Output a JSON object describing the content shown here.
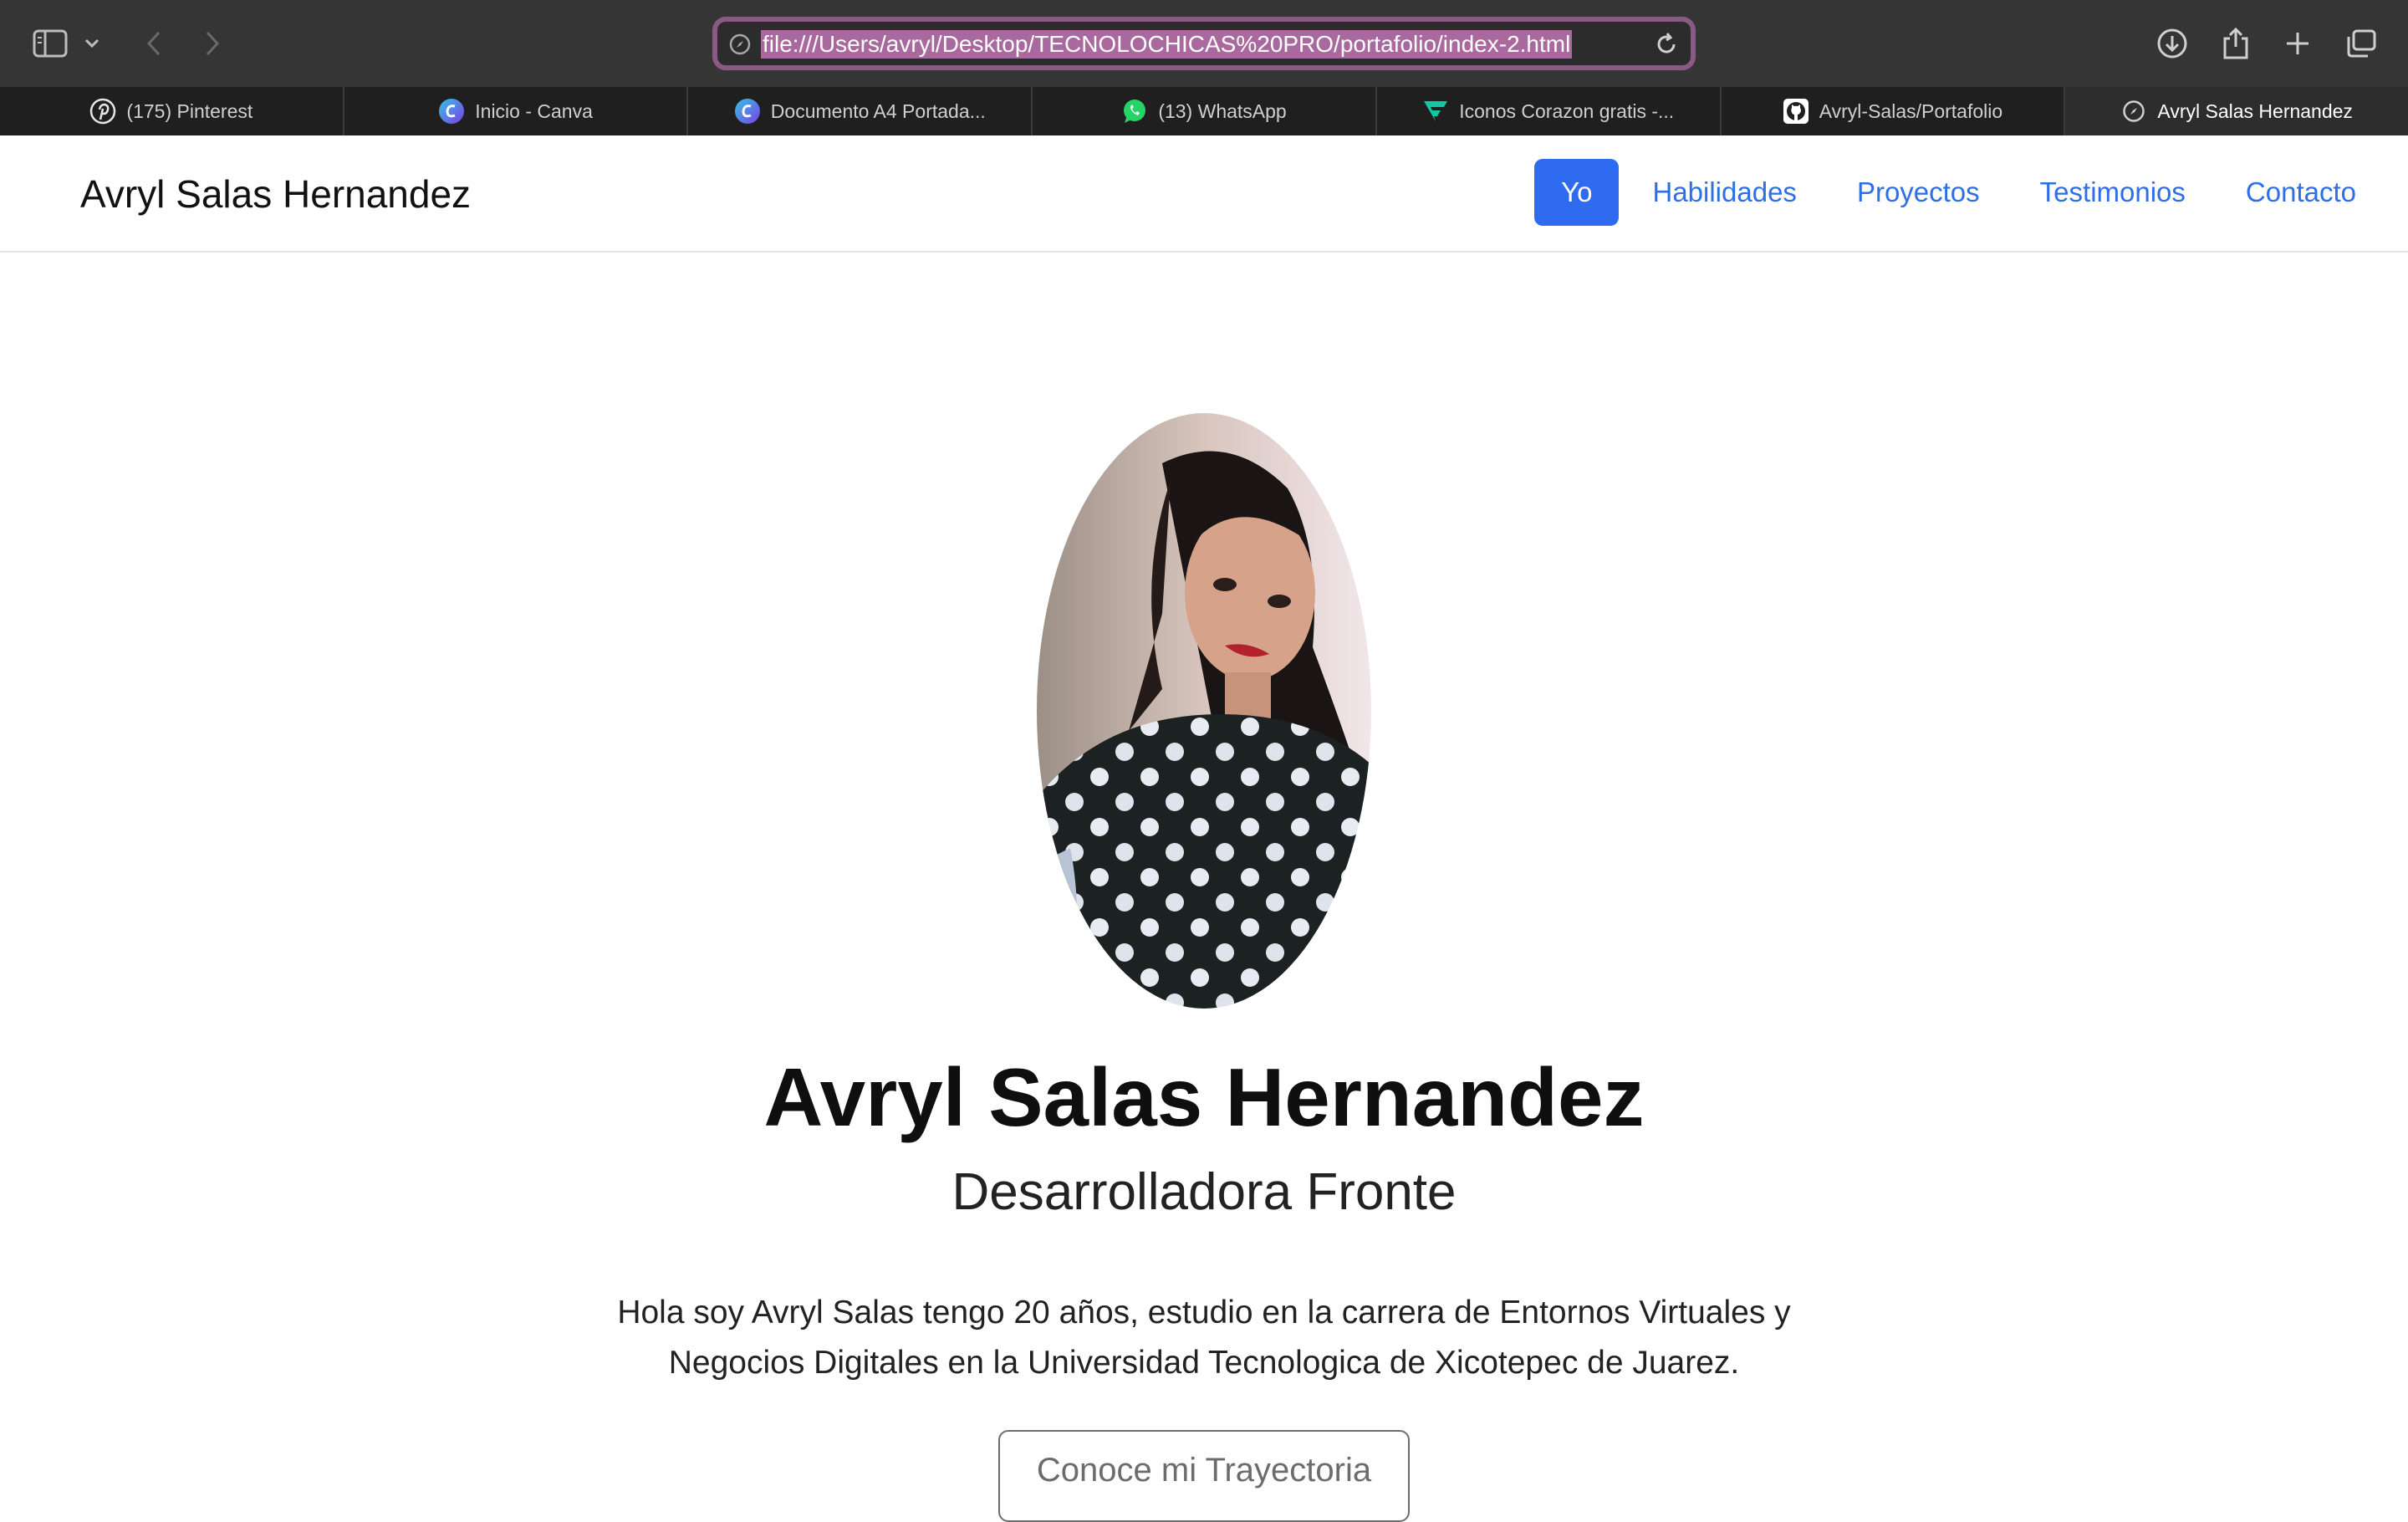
{
  "browser": {
    "url": "file:///Users/avryl/Desktop/TECNOLOCHICAS%20PRO/portafolio/index-2.html",
    "tabs": [
      {
        "label": "(175) Pinterest",
        "icon": "pinterest-icon"
      },
      {
        "label": "Inicio - Canva",
        "icon": "canva-icon"
      },
      {
        "label": "Documento A4 Portada...",
        "icon": "canva-icon"
      },
      {
        "label": "(13) WhatsApp",
        "icon": "whatsapp-icon"
      },
      {
        "label": "Iconos Corazon gratis -...",
        "icon": "flaticon-icon"
      },
      {
        "label": "Avryl-Salas/Portafolio",
        "icon": "github-icon"
      },
      {
        "label": "Avryl Salas Hernandez",
        "icon": "compass-icon"
      }
    ]
  },
  "page": {
    "brand": "Avryl Salas Hernandez",
    "nav": [
      {
        "label": "Yo",
        "active": true
      },
      {
        "label": "Habilidades"
      },
      {
        "label": "Proyectos"
      },
      {
        "label": "Testimonios"
      },
      {
        "label": "Contacto"
      }
    ],
    "hero": {
      "name": "Avryl Salas Hernandez",
      "role": "Desarrolladora Fronte",
      "bio": "Hola soy Avryl Salas tengo 20 años, estudio en la carrera de Entornos Virtuales y Negocios Digitales en la Universidad Tecnologica de Xicotepec de Juarez.",
      "cta": "Conoce mi Trayectoria"
    }
  },
  "colors": {
    "accent": "#2f6bf0",
    "link": "#2f6fe4",
    "toolbar": "#353535",
    "url_highlight": "#a9699f"
  }
}
